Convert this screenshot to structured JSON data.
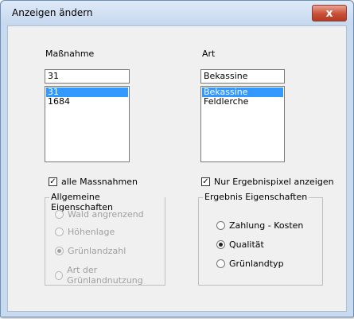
{
  "window": {
    "title": "Anzeigen ändern",
    "close_glyph": "x"
  },
  "massnahme": {
    "label": "Maßnahme",
    "input_value": "31",
    "items": [
      "31",
      "1684"
    ],
    "selected": "31"
  },
  "art": {
    "label": "Art",
    "input_value": "Bekassine",
    "items": [
      "Bekassine",
      "Feldlerche"
    ],
    "selected": "Bekassine"
  },
  "checks": {
    "alle_massnahmen": {
      "label": "alle Massnahmen",
      "checked": true,
      "glyph": "✓"
    },
    "nur_ergebnispixel": {
      "label": "Nur Ergebnispixel anzeigen",
      "checked": true,
      "glyph": "✓"
    }
  },
  "allgemeine": {
    "title": "Allgemeine Eigenschaften",
    "options": [
      {
        "label": "Wald angrenzend",
        "selected": false
      },
      {
        "label": "Höhenlage",
        "selected": false
      },
      {
        "label": "Grünlandzahl",
        "selected": true
      },
      {
        "label": "Art der Grünlandnutzung",
        "selected": false
      }
    ]
  },
  "ergebnis": {
    "title": "Ergebnis Eigenschaften",
    "options": [
      {
        "label": "Zahlung - Kosten",
        "selected": false
      },
      {
        "label": "Qualität",
        "selected": true
      },
      {
        "label": "Grünlandtyp",
        "selected": false
      }
    ]
  }
}
